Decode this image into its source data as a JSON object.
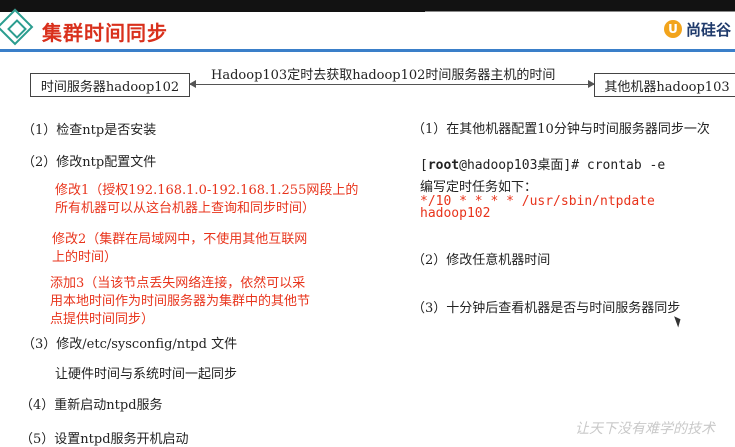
{
  "header": {
    "title": "集群时间同步",
    "brand_mark": "U",
    "brand_text": "尚硅谷"
  },
  "diagram": {
    "left_box": "时间服务器hadoop102",
    "arrow_label": "Hadoop103定时去获取hadoop102时间服务器主机的时间",
    "right_box": "其他机器hadoop103"
  },
  "left": {
    "step1": "（1）检查ntp是否安装",
    "step2": "（2）修改ntp配置文件",
    "mod1_line1": "修改1（授权192.168.1.0-192.168.1.255网段上的",
    "mod1_line2": "所有机器可以从这台机器上查询和同步时间）",
    "mod2_line1": "修改2（集群在局域网中，不使用其他互联网",
    "mod2_line2": "上的时间）",
    "add3_line1": "添加3（当该节点丢失网络连接，依然可以采",
    "add3_line2": "用本地时间作为时间服务器为集群中的其他节",
    "add3_line3": "点提供时间同步）",
    "step3": "（3）修改/etc/sysconfig/ntpd 文件",
    "step3_desc": "让硬件时间与系统时间一起同步",
    "step4": "（4）重新启动ntpd服务",
    "step5": "（5）设置ntpd服务开机启动"
  },
  "right": {
    "step1": "（1）在其他机器配置10分钟与时间服务器同步一次",
    "cmd_prompt_open": "[",
    "cmd_user": "root",
    "cmd_host": "@hadoop103桌面]# crontab -e",
    "cmd_note": "编写定时任务如下：",
    "cron_line": "*/10  *  *  *  *  /usr/sbin/ntpdate",
    "cron_host": "hadoop102",
    "step2": "（2）修改任意机器时间",
    "step3": "（3）十分钟后查看机器是否与时间服务器同步"
  },
  "watermark": "让天下没有难学的技术",
  "colors": {
    "title": "#d9301c",
    "accent_red": "#e8341c",
    "rule_blue": "#3a7fc9",
    "logo_teal": "#2b9d8f"
  }
}
